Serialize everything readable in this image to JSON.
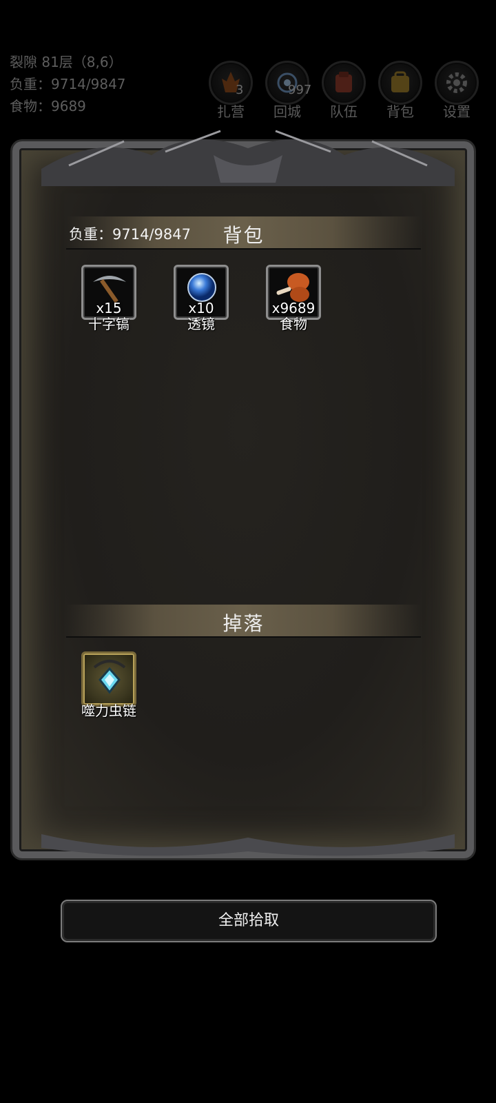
{
  "hud": {
    "location": "裂隙 81层（8,6）",
    "weight": "负重：9714/9847",
    "food": "食物：9689"
  },
  "top_actions": [
    {
      "label": "扎营",
      "badge": "3",
      "icon": "campfire-icon"
    },
    {
      "label": "回城",
      "badge": "997",
      "icon": "portal-icon"
    },
    {
      "label": "队伍",
      "badge": "",
      "icon": "team-icon"
    },
    {
      "label": "背包",
      "badge": "",
      "icon": "backpack-icon"
    },
    {
      "label": "设置",
      "badge": "",
      "icon": "gear-icon"
    }
  ],
  "backpack": {
    "title": "背包",
    "weight_label": "负重：9714/9847",
    "items": [
      {
        "name": "十字镐",
        "qty": "x15",
        "icon": "pickaxe-icon"
      },
      {
        "name": "透镜",
        "qty": "x10",
        "icon": "lens-icon"
      },
      {
        "name": "食物",
        "qty": "x9689",
        "icon": "meat-icon"
      }
    ]
  },
  "drops": {
    "title": "掉落",
    "items": [
      {
        "name": "噬力虫链",
        "qty": "",
        "icon": "amulet-icon"
      }
    ]
  },
  "pickup_all_label": "全部拾取",
  "colors": {
    "background": "#000000",
    "panel": "#201e1b",
    "frame": "#5a5a5c",
    "section_bar": "#6a604b"
  }
}
